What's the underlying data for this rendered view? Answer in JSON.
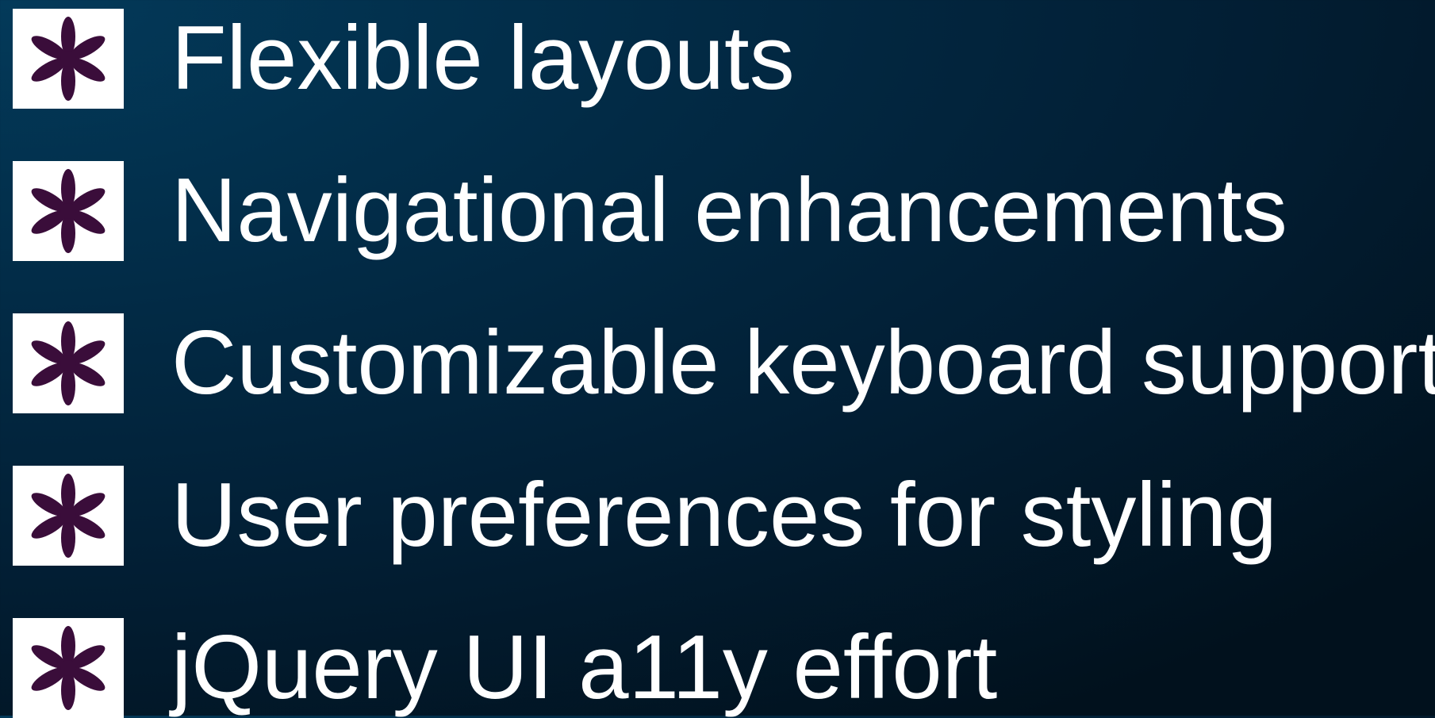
{
  "slide": {
    "bullet_icon": "asterisk-flower-icon",
    "bullet_color": "#3a0d3a",
    "items": [
      {
        "text": "Flexible layouts"
      },
      {
        "text": "Navigational enhancements"
      },
      {
        "text": "Customizable keyboard support"
      },
      {
        "text": "User preferences for styling"
      },
      {
        "text": "jQuery UI a11y effort"
      }
    ]
  }
}
